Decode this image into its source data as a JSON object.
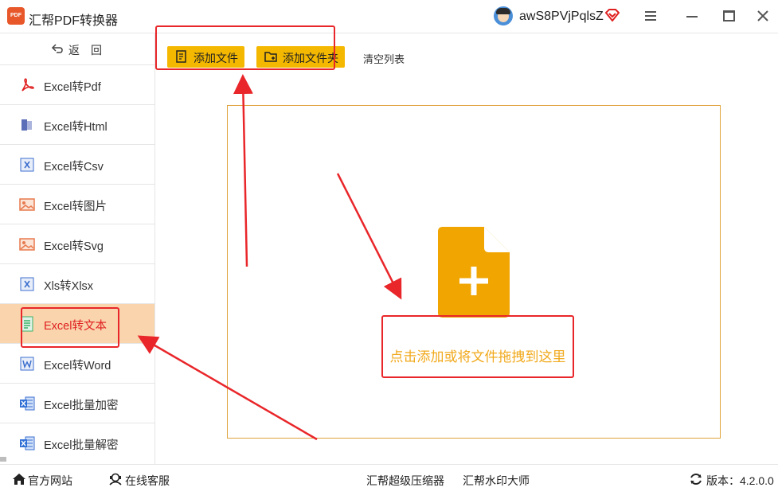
{
  "app": {
    "title": "汇帮PDF转换器",
    "logo_text": "PDF",
    "username": "awS8PVjPqlsZ"
  },
  "sidebar": {
    "back_label": "返回",
    "items": [
      {
        "label": "Excel转Pdf",
        "icon": "pdf-icon"
      },
      {
        "label": "Excel转Html",
        "icon": "html-icon"
      },
      {
        "label": "Excel转Csv",
        "icon": "csv-icon"
      },
      {
        "label": "Excel转图片",
        "icon": "image-icon"
      },
      {
        "label": "Excel转Svg",
        "icon": "svg-image-icon"
      },
      {
        "label": "Xls转Xlsx",
        "icon": "xlsx-icon"
      },
      {
        "label": "Excel转文本",
        "icon": "text-doc-icon",
        "active": true
      },
      {
        "label": "Excel转Word",
        "icon": "word-icon"
      },
      {
        "label": "Excel批量加密",
        "icon": "excel-lock-icon"
      },
      {
        "label": "Excel批量解密",
        "icon": "excel-unlock-icon"
      }
    ]
  },
  "toolbar": {
    "add_file": "添加文件",
    "add_folder": "添加文件夹",
    "clear_list": "清空列表"
  },
  "dropzone": {
    "text": "点击添加或将文件拖拽到这里"
  },
  "footer": {
    "website": "官方网站",
    "support": "在线客服",
    "compressor": "汇帮超级压缩器",
    "watermark": "汇帮水印大师",
    "version": "版本：4.2.0.0"
  },
  "colors": {
    "accent": "#f5b800",
    "active_item_bg": "#f9d4ad",
    "active_item_text": "#e02020",
    "annotation": "#e9262a",
    "drop_text": "#f1a91c",
    "file_icon": "#f0a500"
  }
}
